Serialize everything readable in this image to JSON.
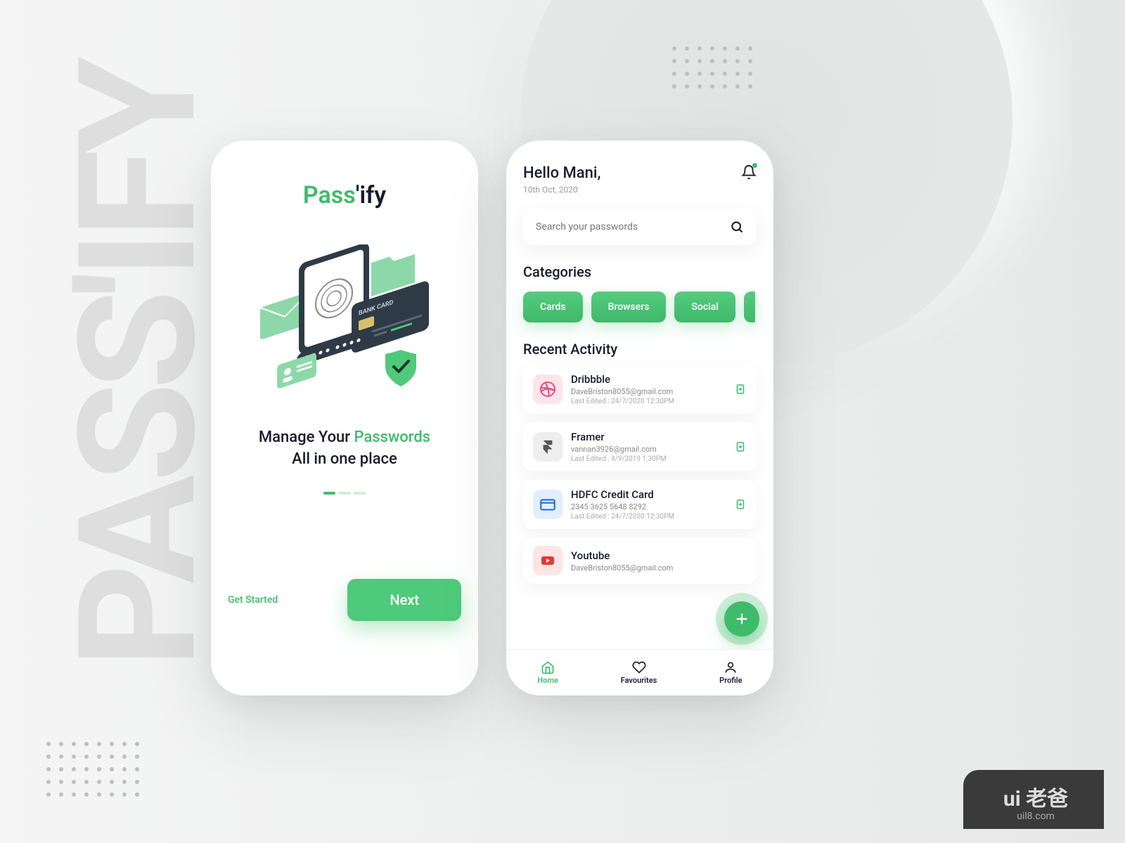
{
  "background": {
    "word": "PASS'IFY"
  },
  "colors": {
    "accent": "#3fbb6c",
    "dark": "#1a1a2e"
  },
  "splash": {
    "logo": {
      "part1": "Pass",
      "part2": "'ify"
    },
    "tagline1_a": "Manage Your ",
    "tagline1_b": "Passwords",
    "tagline2": "All in one place",
    "get_started": "Get Started",
    "next": "Next"
  },
  "home": {
    "greeting": "Hello Mani,",
    "date": "10th Oct, 2020",
    "search_placeholder": "Search your passwords",
    "categories_title": "Categories",
    "categories": [
      "Cards",
      "Browsers",
      "Social"
    ],
    "recent_title": "Recent Activity",
    "items": [
      {
        "name": "Dribbble",
        "sub": "DaveBriston8055@gmail.com",
        "meta": "Last Edited : 24/7/2020  12:30PM",
        "icon_bg": "#fde5ea",
        "icon": "dribbble"
      },
      {
        "name": "Framer",
        "sub": "vannan3926@gmail.com",
        "meta": "Last Edited : 4/9/2019  1:30PM",
        "icon_bg": "#eeeeee",
        "icon": "framer"
      },
      {
        "name": "HDFC Credit Card",
        "sub": "2345 3625 5648 8292",
        "meta": "Last Edited : 24/7/2020  12:30PM",
        "icon_bg": "#e3eefc",
        "icon": "card"
      },
      {
        "name": "Youtube",
        "sub": "DaveBriston8055@gmail.com",
        "meta": "",
        "icon_bg": "#fde5e5",
        "icon": "youtube"
      }
    ],
    "tabs": {
      "home": "Home",
      "fav": "Favourites",
      "profile": "Profile"
    }
  },
  "watermark": {
    "big": "ui 老爸",
    "small": "uil8.com"
  }
}
